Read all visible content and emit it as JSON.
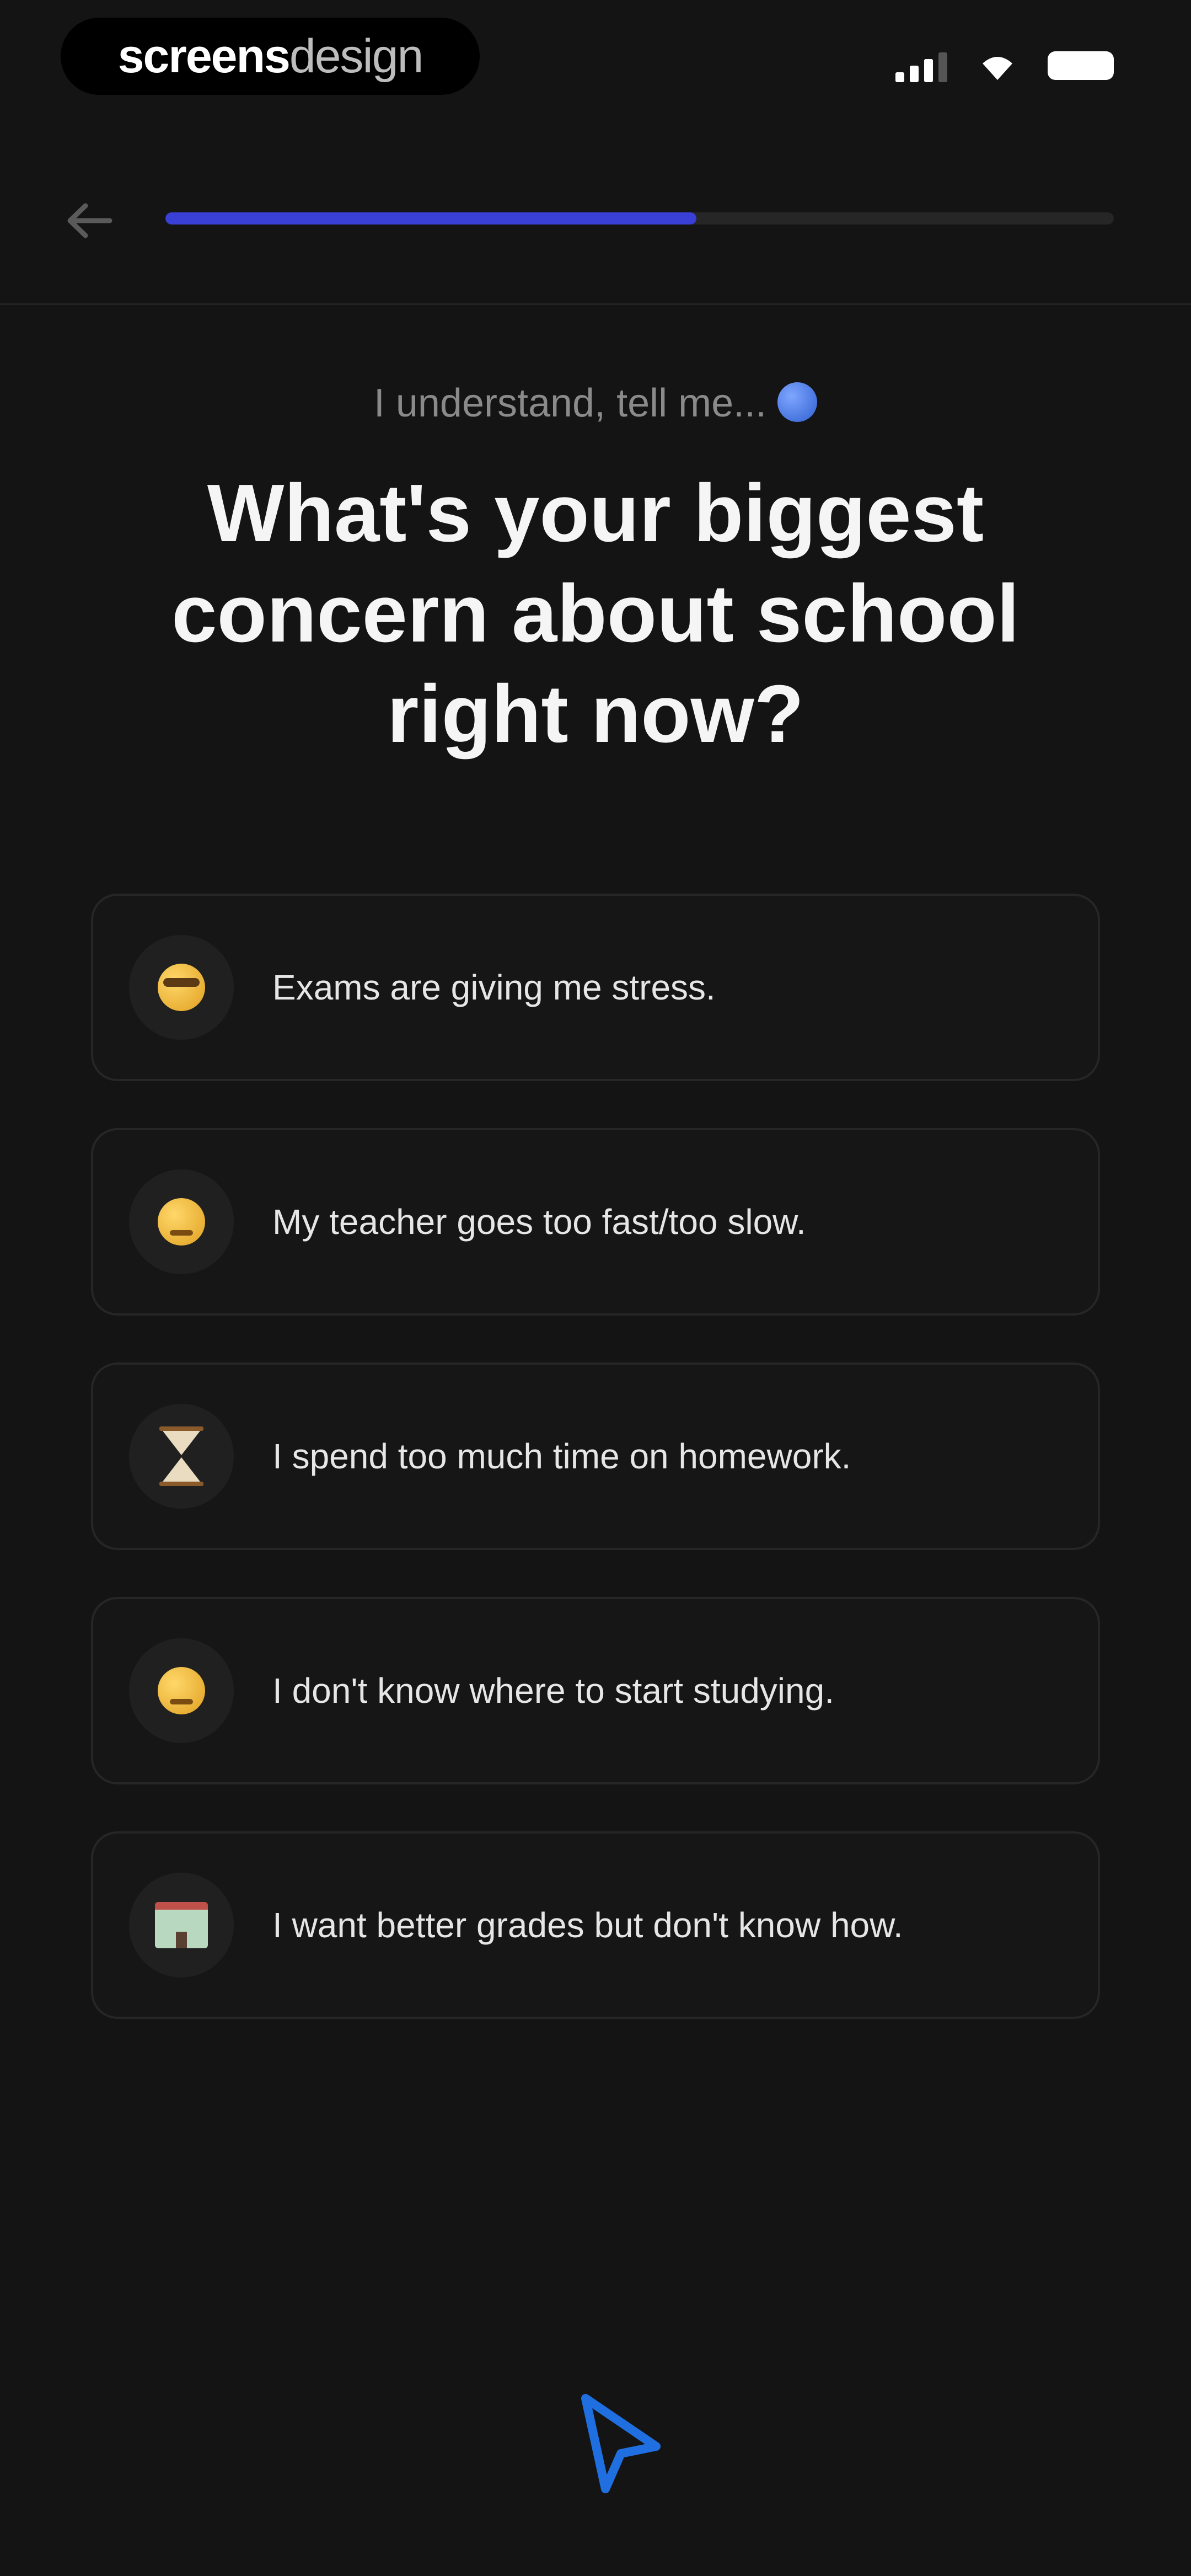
{
  "status_bar": {
    "brand_bold": "screens",
    "brand_light": "design",
    "icons": [
      "signal-icon",
      "wifi-icon",
      "battery-icon"
    ]
  },
  "header": {
    "back_icon": "arrow-left-icon",
    "progress": 0.56,
    "progress_color": "#3a3fd6"
  },
  "question": {
    "kicker": "I understand, tell me...",
    "kicker_icon": "globe-icon",
    "title": "What's your biggest concern about school right now?"
  },
  "options": [
    {
      "icon": "anxious-face-icon",
      "label": "Exams are giving me stress."
    },
    {
      "icon": "grimacing-face-icon",
      "label": "My teacher goes too fast/too slow."
    },
    {
      "icon": "hourglass-icon",
      "label": "I spend too much time on homework."
    },
    {
      "icon": "confused-face-icon",
      "label": "I don't know where to start studying."
    },
    {
      "icon": "school-icon",
      "label": "I want better grades but don't know how."
    }
  ],
  "footer": {
    "cursor_icon": "cursor-arrow-icon",
    "accent": "#1f6fe0"
  }
}
